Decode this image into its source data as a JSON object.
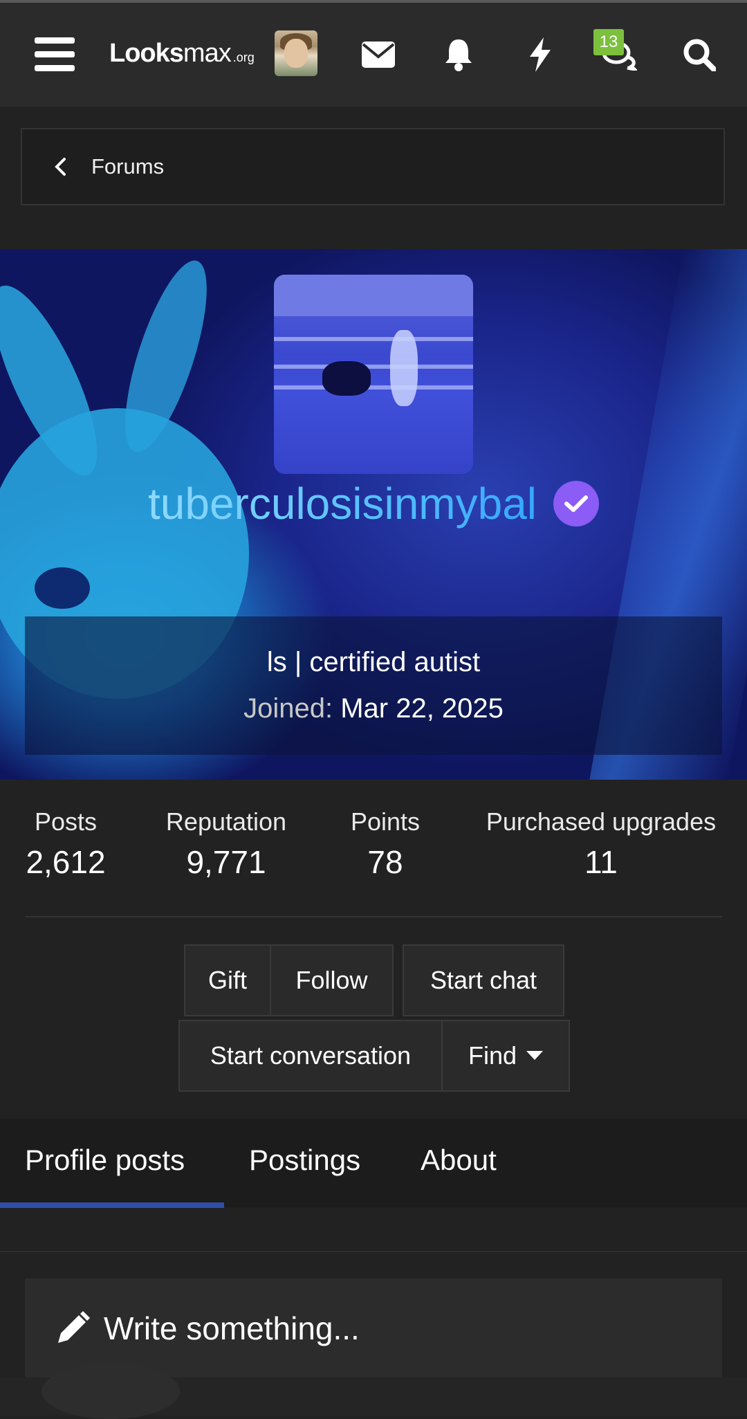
{
  "navbar": {
    "logo_main_1": "L",
    "logo_main_2": "ooks",
    "logo_main_3": "max",
    "logo_suffix": ".org",
    "conversations_badge": "13",
    "icons": [
      "menu-icon",
      "envelope-icon",
      "bell-icon",
      "lightning-icon",
      "chat-icon",
      "search-icon"
    ]
  },
  "breadcrumb": {
    "label": "Forums"
  },
  "profile": {
    "username": "tuberculosisinmybal",
    "title": "ls | certified autist",
    "joined_label": "Joined:",
    "joined_value": "Mar 22, 2025",
    "accent_color": "#8b5cf6"
  },
  "stats": [
    {
      "label": "Posts",
      "value": "2,612"
    },
    {
      "label": "Reputation",
      "value": "9,771"
    },
    {
      "label": "Points",
      "value": "78"
    },
    {
      "label": "Purchased upgrades",
      "value": "11"
    }
  ],
  "actions": {
    "gift": "Gift",
    "follow": "Follow",
    "start_chat": "Start chat",
    "start_conversation": "Start conversation",
    "find": "Find"
  },
  "tabs": [
    {
      "label": "Profile posts",
      "active": true
    },
    {
      "label": "Postings",
      "active": false
    },
    {
      "label": "About",
      "active": false
    }
  ],
  "composer": {
    "placeholder": "Write something..."
  }
}
